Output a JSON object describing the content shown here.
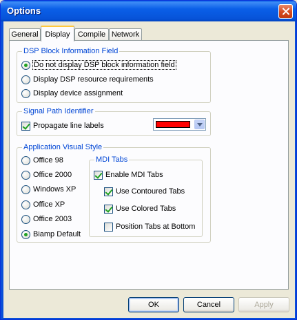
{
  "window": {
    "title": "Options"
  },
  "tabs": [
    {
      "label": "General",
      "active": false
    },
    {
      "label": "Display",
      "active": true
    },
    {
      "label": "Compile",
      "active": false
    },
    {
      "label": "Network",
      "active": false
    }
  ],
  "dsp_group": {
    "label": "DSP Block Information Field",
    "options": [
      {
        "label": "Do not display DSP block information field",
        "checked": true
      },
      {
        "label": "Display DSP resource requirements",
        "checked": false
      },
      {
        "label": "Display device assignment",
        "checked": false
      }
    ]
  },
  "signal_group": {
    "label": "Signal Path Identifier",
    "propagate_label": "Propagate line labels",
    "propagate_checked": true,
    "color": "#ff0000"
  },
  "visual_group": {
    "label": "Application Visual Style",
    "styles": [
      {
        "label": "Office 98",
        "checked": false
      },
      {
        "label": "Office 2000",
        "checked": false
      },
      {
        "label": "Windows XP",
        "checked": false
      },
      {
        "label": "Office XP",
        "checked": false
      },
      {
        "label": "Office 2003",
        "checked": false
      },
      {
        "label": "Biamp Default",
        "checked": true
      }
    ],
    "mdi": {
      "label": "MDI Tabs",
      "enable_label": "Enable MDI Tabs",
      "enable_checked": true,
      "contoured_label": "Use Contoured Tabs",
      "contoured_checked": true,
      "colored_label": "Use Colored Tabs",
      "colored_checked": true,
      "bottom_label": "Position Tabs at Bottom",
      "bottom_checked": false
    }
  },
  "buttons": {
    "ok": "OK",
    "cancel": "Cancel",
    "apply": "Apply"
  }
}
